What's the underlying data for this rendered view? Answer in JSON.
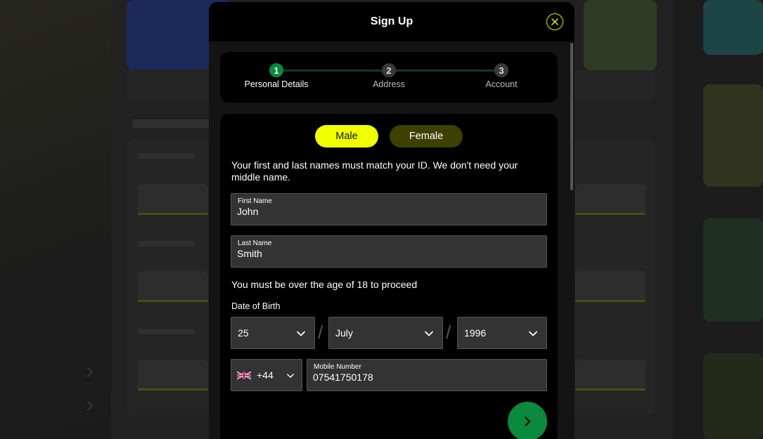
{
  "modal": {
    "title": "Sign Up"
  },
  "stepper": {
    "steps": [
      {
        "number": "1",
        "label": "Personal Details",
        "active": true
      },
      {
        "number": "2",
        "label": "Address",
        "active": false
      },
      {
        "number": "3",
        "label": "Account",
        "active": false
      }
    ]
  },
  "gender": {
    "male": "Male",
    "female": "Female",
    "selected": "Male"
  },
  "form": {
    "name_info": "Your first and last names must match your ID. We don't need your middle name.",
    "first_name_label": "First Name",
    "first_name_value": "John",
    "last_name_label": "Last Name",
    "last_name_value": "Smith",
    "age_note": "You must be over the age of 18 to proceed",
    "dob_label": "Date of Birth",
    "dob_day": "25",
    "dob_month": "July",
    "dob_year": "1996",
    "dob_separator": "/",
    "phone_country_code": "+44",
    "mobile_label": "Mobile Number",
    "mobile_value": "07541750178"
  },
  "icons": {
    "close": "close-icon",
    "chevron": "chevron-down-icon",
    "flag": "uk-flag-icon",
    "next": "chevron-right-icon"
  },
  "colors": {
    "accent_yellow": "#f2ff00",
    "accent_green": "#0a8a3c",
    "female_bg": "#3d4100",
    "close_ring": "#e6f200"
  }
}
